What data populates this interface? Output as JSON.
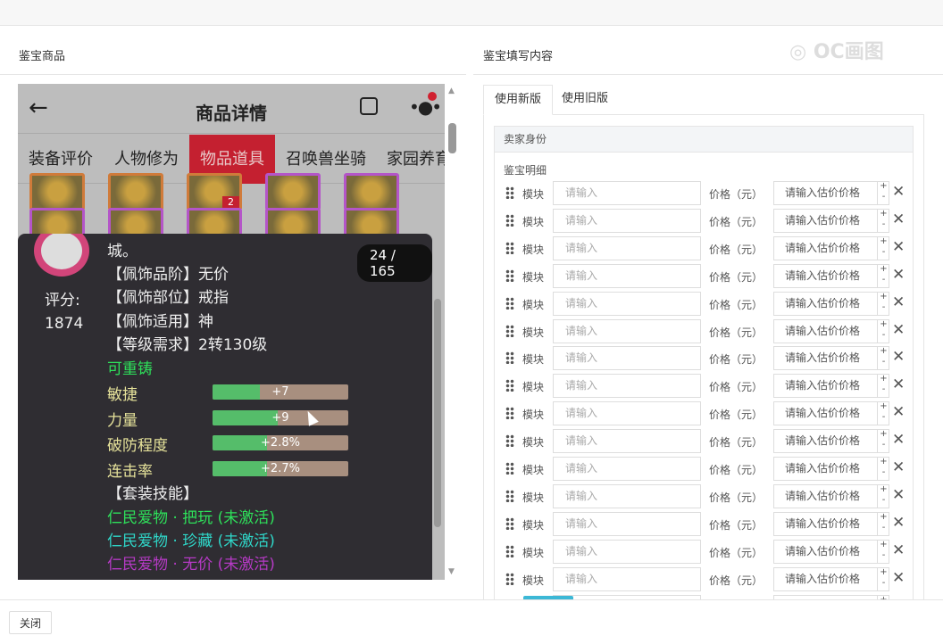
{
  "left_title": "鉴宝商品",
  "right_title": "鉴宝填写内容",
  "watermark": "◎ OC画图",
  "phone": {
    "title": "商品详情",
    "tabs": [
      "装备评价",
      "人物修为",
      "物品道具",
      "召唤兽坐骑",
      "家园养育"
    ],
    "active_tab": 2,
    "item_badge": "2"
  },
  "popup": {
    "name": "城。",
    "counter": "24 / 165",
    "score_label": "评分:",
    "score": "1874",
    "lines": [
      "【佩饰品阶】无价",
      "【佩饰部位】戒指",
      "【佩饰适用】神",
      "【等级需求】2转130级"
    ],
    "recast": "可重铸",
    "stats": [
      {
        "name": "敏捷",
        "value": "+7",
        "fill": 0.35
      },
      {
        "name": "力量",
        "value": "+9",
        "fill": 0.48
      },
      {
        "name": "破防程度",
        "value": "+2.8%",
        "fill": 0.4
      },
      {
        "name": "连击率",
        "value": "+2.7%",
        "fill": 0.4
      }
    ],
    "set_title": "【套装技能】",
    "set_skills": [
      "仁民爱物 · 把玩 (未激活)",
      "仁民爱物 · 珍藏 (未激活)",
      "仁民爱物 · 无价 (未激活)"
    ]
  },
  "form": {
    "tabs": [
      "使用新版",
      "使用旧版"
    ],
    "seller_section": "卖家身份",
    "detail_label": "鉴宝明细",
    "row_label": "模块",
    "row_placeholder": "请输入",
    "price_label": "价格（元）",
    "price_placeholder": "请输入估价价格",
    "row_count": 16
  },
  "footer": {
    "close": "关闭"
  }
}
